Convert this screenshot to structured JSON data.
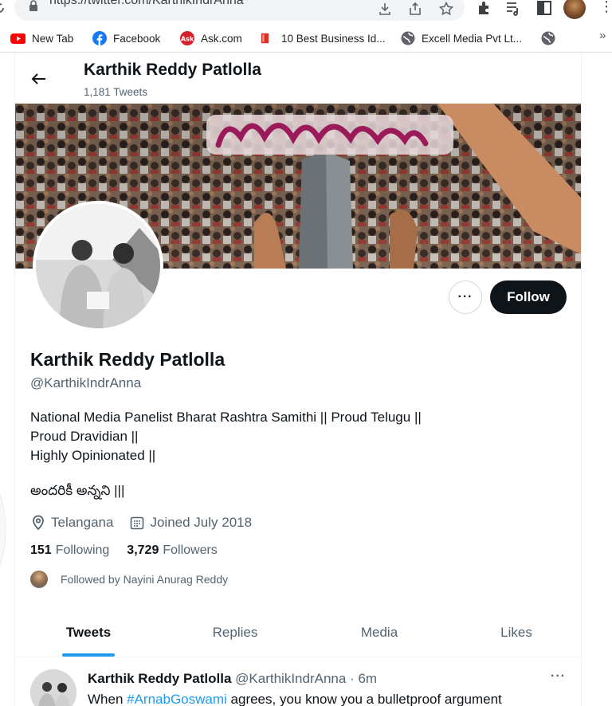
{
  "browser": {
    "url": "https://twitter.com/KarthikIndrAnna",
    "bookmarks": [
      {
        "label": "New Tab",
        "icon": "youtube-icon"
      },
      {
        "label": "Facebook",
        "icon": "facebook-icon"
      },
      {
        "label": "Ask.com",
        "icon": "ask-icon"
      },
      {
        "label": "10 Best Business Id...",
        "icon": "bookmark-red-icon"
      },
      {
        "label": "Excell Media Pvt Lt...",
        "icon": "globe-icon"
      }
    ],
    "more_glyph": "»"
  },
  "header": {
    "name": "Karthik Reddy Patlolla",
    "tweet_count": "1,181 Tweets"
  },
  "profile": {
    "name": "Karthik Reddy Patlolla",
    "handle": "@KarthikIndrAnna",
    "bio_lines": [
      "National Media Panelist Bharat Rashtra Samithi || Proud Telugu ||",
      "Proud Dravidian ||",
      "Highly Opinionated ||"
    ],
    "bio_telugu": "అందరికీ అన్నని |||",
    "location": "Telangana",
    "joined": "Joined July 2018",
    "following_count": "151",
    "following_label": "Following",
    "followers_count": "3,729",
    "followers_label": "Followers",
    "followed_by": "Followed by Nayini Anurag Reddy",
    "follow_label": "Follow",
    "more_label": "···"
  },
  "tabs": [
    {
      "label": "Tweets",
      "active": true
    },
    {
      "label": "Replies",
      "active": false
    },
    {
      "label": "Media",
      "active": false
    },
    {
      "label": "Likes",
      "active": false
    }
  ],
  "tweet": {
    "name": "Karthik Reddy Patlolla",
    "handle_time": "@KarthikIndrAnna · 6m",
    "text_pre": "When ",
    "hashtag": "#ArnabGoswami",
    "text_post": " agrees, you know you a bulletproof argument",
    "more_label": "···"
  },
  "colors": {
    "accent": "#1d9bf0",
    "follow_bg": "#0f1419",
    "secondary_text": "#536471"
  }
}
